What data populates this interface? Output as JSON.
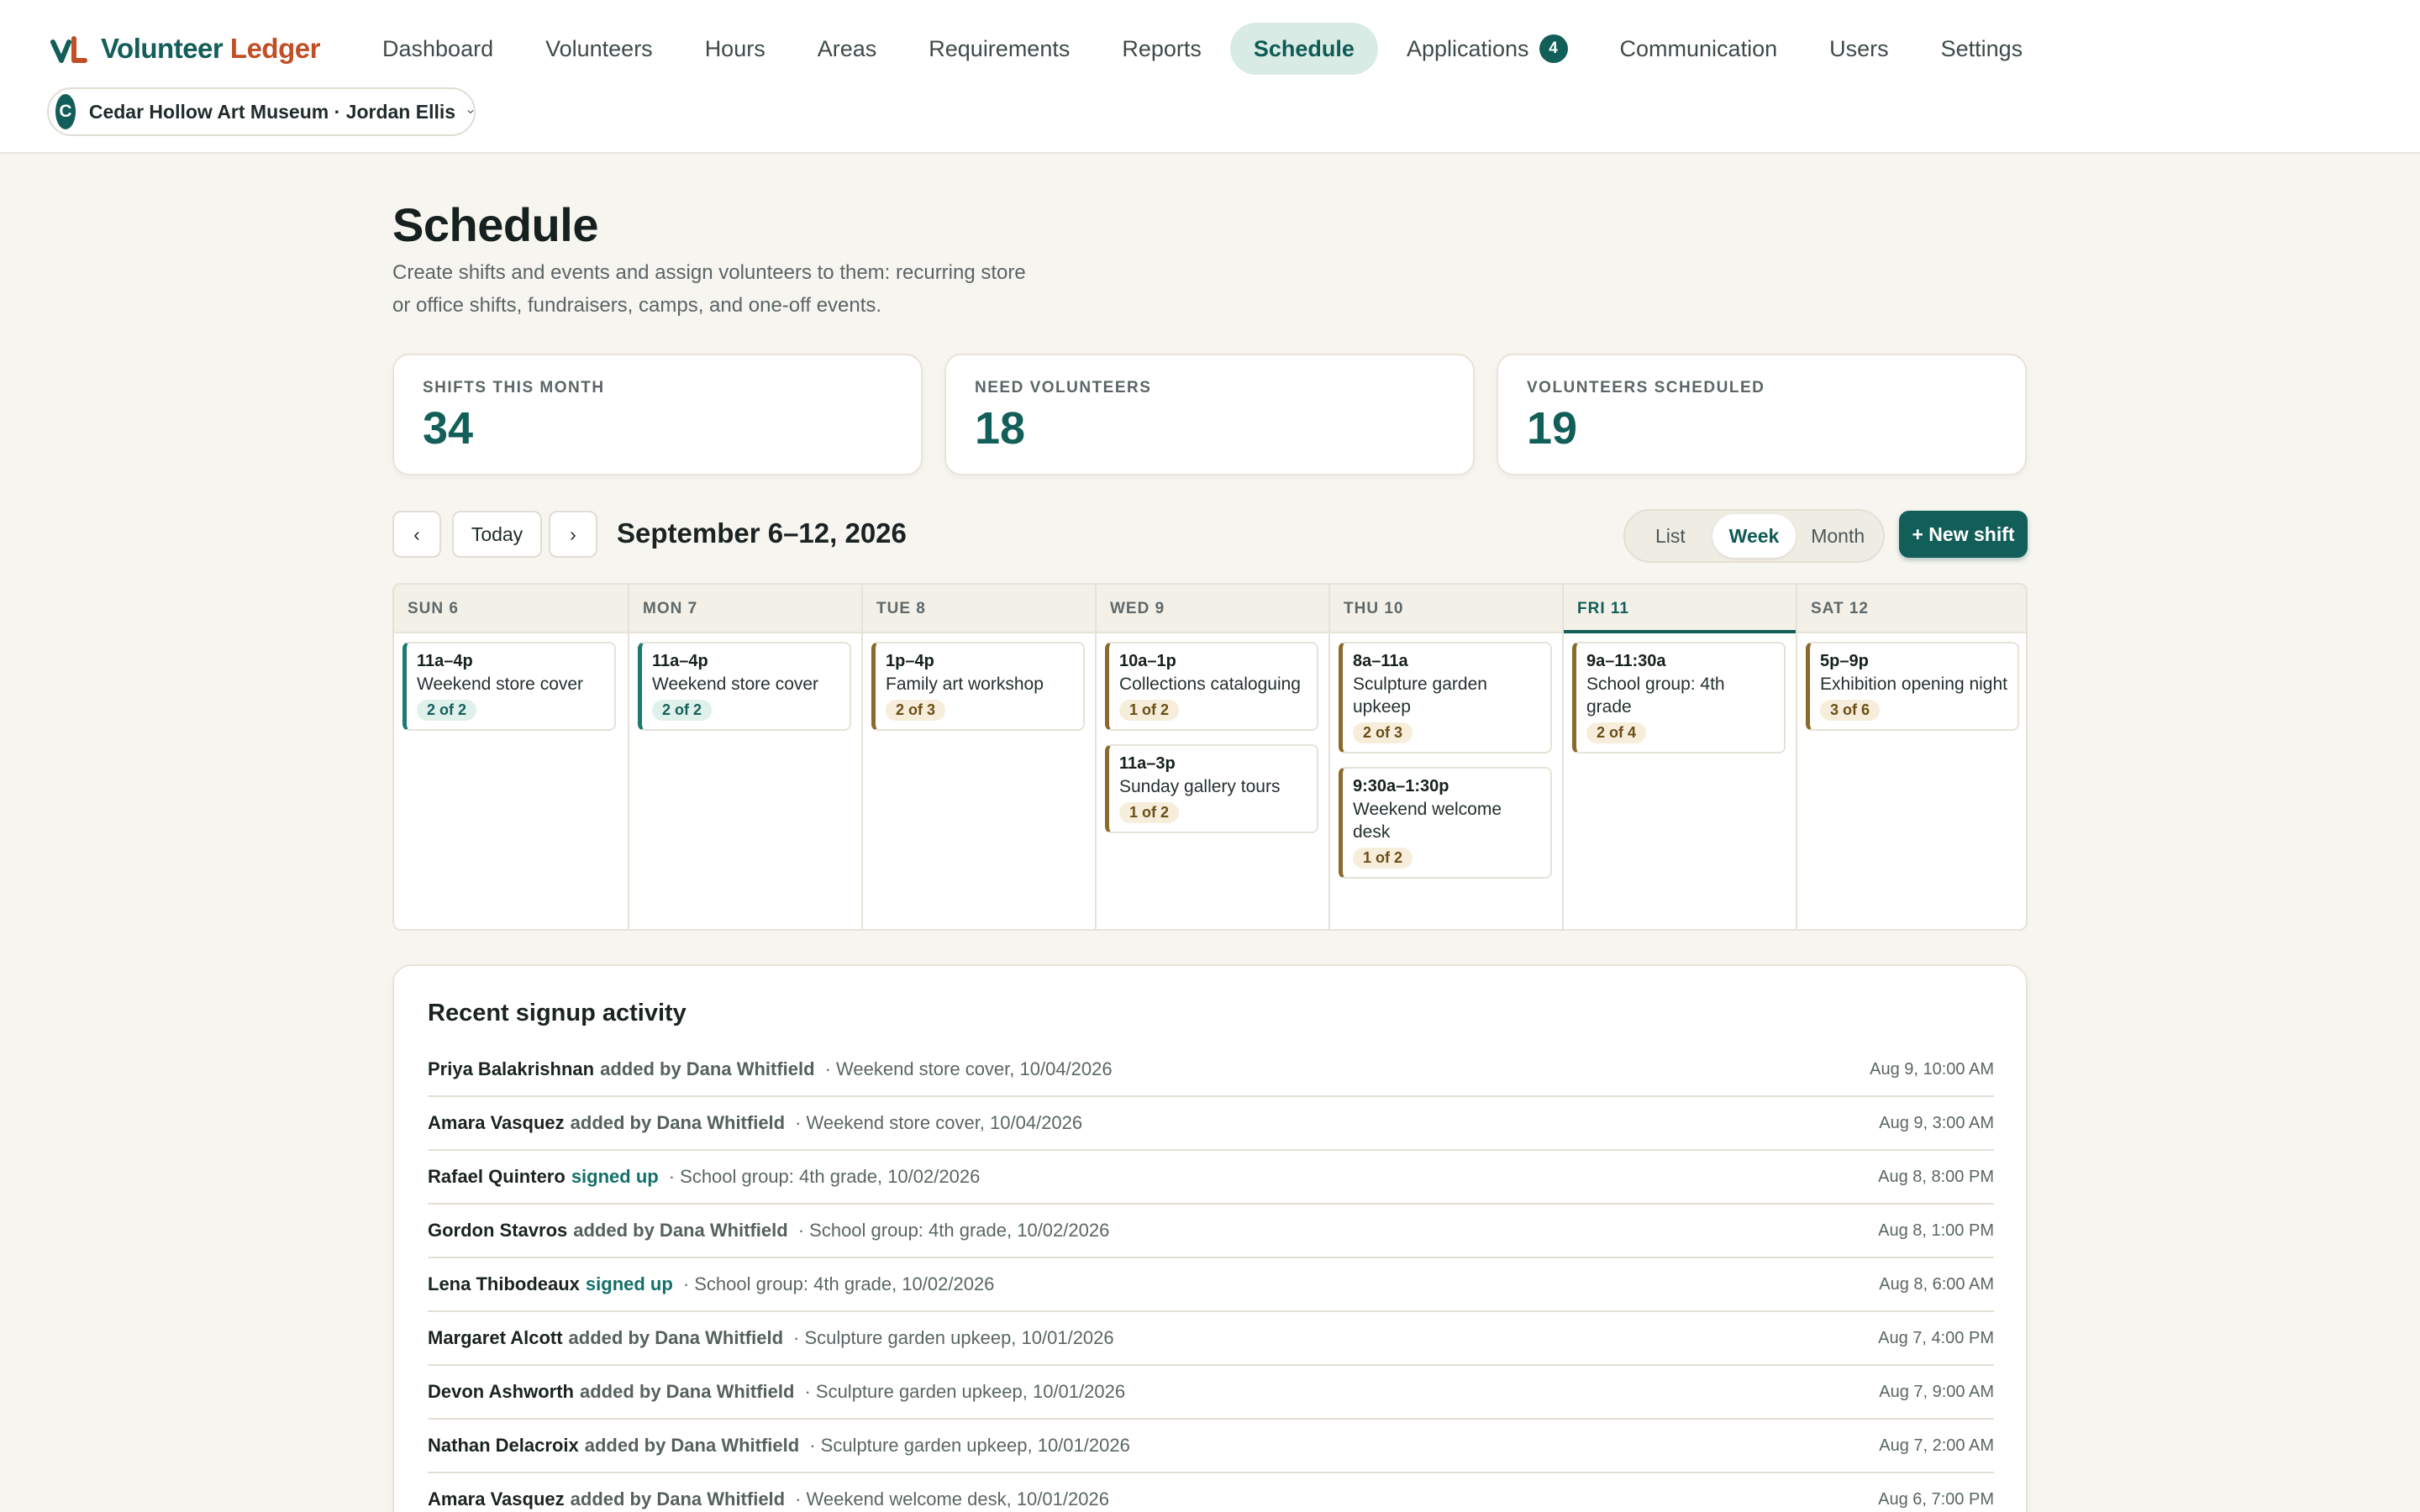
{
  "brand": {
    "name_part1": "Volunteer",
    "name_part2": "Ledger",
    "colors": {
      "primary": "#125e58",
      "accent": "#c04f25"
    }
  },
  "nav": {
    "items": [
      {
        "label": "Dashboard"
      },
      {
        "label": "Volunteers"
      },
      {
        "label": "Hours"
      },
      {
        "label": "Areas"
      },
      {
        "label": "Requirements"
      },
      {
        "label": "Reports"
      },
      {
        "label": "Schedule",
        "active": true
      },
      {
        "label": "Applications",
        "badge": "4"
      },
      {
        "label": "Communication"
      },
      {
        "label": "Users"
      },
      {
        "label": "Settings"
      }
    ]
  },
  "org": {
    "initial": "C",
    "label": "Cedar Hollow Art Museum · Jordan Ellis",
    "icon": "chevron-down-icon"
  },
  "page": {
    "title": "Schedule",
    "description": "Create shifts and events and assign volunteers to them: recurring store or office shifts, fundraisers, camps, and one-off events."
  },
  "stats": [
    {
      "label": "SHIFTS THIS MONTH",
      "value": "34"
    },
    {
      "label": "NEED VOLUNTEERS",
      "value": "18"
    },
    {
      "label": "VOLUNTEERS SCHEDULED",
      "value": "19"
    }
  ],
  "toolbar": {
    "prev": "‹",
    "today": "Today",
    "next": "›",
    "range": "September 6–12, 2026",
    "views": [
      "List",
      "Week",
      "Month"
    ],
    "active_view": "Week",
    "new_shift": "+ New shift"
  },
  "calendar": {
    "days": [
      {
        "label": "SUN 6",
        "shifts": [
          {
            "time": "11a–4p",
            "title": "Weekend store cover",
            "fill": "2 of 2",
            "status": "ok"
          }
        ]
      },
      {
        "label": "MON 7",
        "shifts": [
          {
            "time": "11a–4p",
            "title": "Weekend store cover",
            "fill": "2 of 2",
            "status": "ok"
          }
        ]
      },
      {
        "label": "TUE 8",
        "shifts": [
          {
            "time": "1p–4p",
            "title": "Family art workshop",
            "fill": "2 of 3",
            "status": "need"
          }
        ]
      },
      {
        "label": "WED 9",
        "shifts": [
          {
            "time": "10a–1p",
            "title": "Collections cataloguing",
            "fill": "1 of 2",
            "status": "need"
          },
          {
            "time": "11a–3p",
            "title": "Sunday gallery tours",
            "fill": "1 of 2",
            "status": "need"
          }
        ]
      },
      {
        "label": "THU 10",
        "shifts": [
          {
            "time": "8a–11a",
            "title": "Sculpture garden upkeep",
            "fill": "2 of 3",
            "status": "need"
          },
          {
            "time": "9:30a–1:30p",
            "title": "Weekend welcome desk",
            "fill": "1 of 2",
            "status": "need"
          }
        ]
      },
      {
        "label": "FRI 11",
        "today": true,
        "shifts": [
          {
            "time": "9a–11:30a",
            "title": "School group: 4th grade",
            "fill": "2 of 4",
            "status": "need"
          }
        ]
      },
      {
        "label": "SAT 12",
        "shifts": [
          {
            "time": "5p–9p",
            "title": "Exhibition opening night",
            "fill": "3 of 6",
            "status": "need"
          }
        ]
      }
    ]
  },
  "activity": {
    "title": "Recent signup activity",
    "rows": [
      {
        "name": "Priya Balakrishnan",
        "verb": "added by Dana Whitfield",
        "kind": "added",
        "detail": "· Weekend store cover, 10/04/2026",
        "time": "Aug 9, 10:00 AM"
      },
      {
        "name": "Amara Vasquez",
        "verb": "added by Dana Whitfield",
        "kind": "added",
        "detail": "· Weekend store cover, 10/04/2026",
        "time": "Aug 9, 3:00 AM"
      },
      {
        "name": "Rafael Quintero",
        "verb": "signed up",
        "kind": "signed",
        "detail": "· School group: 4th grade, 10/02/2026",
        "time": "Aug 8, 8:00 PM"
      },
      {
        "name": "Gordon Stavros",
        "verb": "added by Dana Whitfield",
        "kind": "added",
        "detail": "· School group: 4th grade, 10/02/2026",
        "time": "Aug 8, 1:00 PM"
      },
      {
        "name": "Lena Thibodeaux",
        "verb": "signed up",
        "kind": "signed",
        "detail": "· School group: 4th grade, 10/02/2026",
        "time": "Aug 8, 6:00 AM"
      },
      {
        "name": "Margaret Alcott",
        "verb": "added by Dana Whitfield",
        "kind": "added",
        "detail": "· Sculpture garden upkeep, 10/01/2026",
        "time": "Aug 7, 4:00 PM"
      },
      {
        "name": "Devon Ashworth",
        "verb": "added by Dana Whitfield",
        "kind": "added",
        "detail": "· Sculpture garden upkeep, 10/01/2026",
        "time": "Aug 7, 9:00 AM"
      },
      {
        "name": "Nathan Delacroix",
        "verb": "added by Dana Whitfield",
        "kind": "added",
        "detail": "· Sculpture garden upkeep, 10/01/2026",
        "time": "Aug 7, 2:00 AM"
      },
      {
        "name": "Amara Vasquez",
        "verb": "added by Dana Whitfield",
        "kind": "added",
        "detail": "· Weekend welcome desk, 10/01/2026",
        "time": "Aug 6, 7:00 PM"
      }
    ]
  }
}
